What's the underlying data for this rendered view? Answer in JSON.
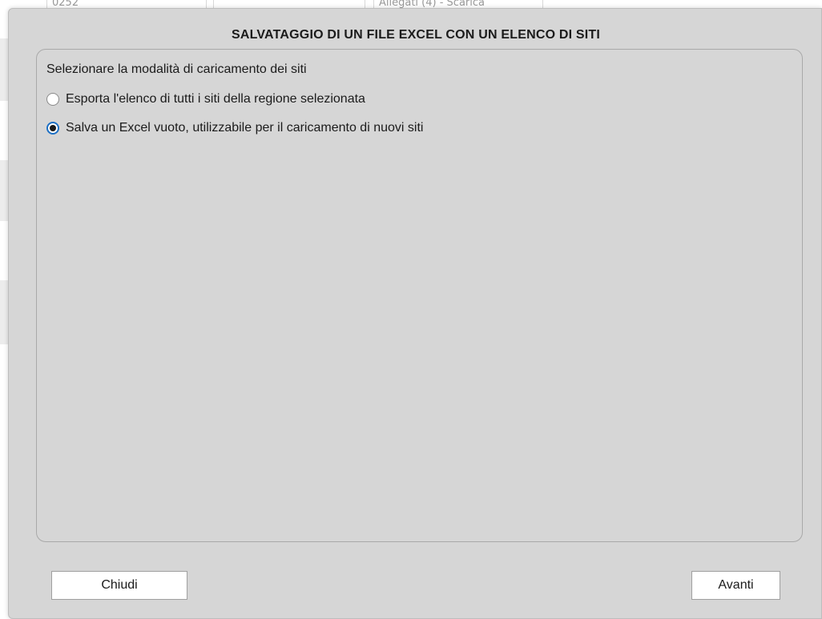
{
  "background": {
    "fields": [
      "0252",
      "",
      "Allegati (4) - Scarica"
    ]
  },
  "dialog": {
    "title": "SALVATAGGIO DI UN FILE EXCEL CON UN ELENCO DI SITI",
    "group": {
      "label": "Selezionare la modalità di caricamento dei siti",
      "options": [
        {
          "label": "Esporta l'elenco di tutti i siti della regione selezionata",
          "selected": false
        },
        {
          "label": "Salva un Excel vuoto, utilizzabile per il caricamento di nuovi siti",
          "selected": true
        }
      ]
    },
    "buttons": {
      "close_label": "Chiudi",
      "next_label": "Avanti"
    }
  },
  "colors": {
    "dialog_bg": "#d6d6d6",
    "radio_accent": "#1c6fc4",
    "button_bg": "#ffffff"
  }
}
